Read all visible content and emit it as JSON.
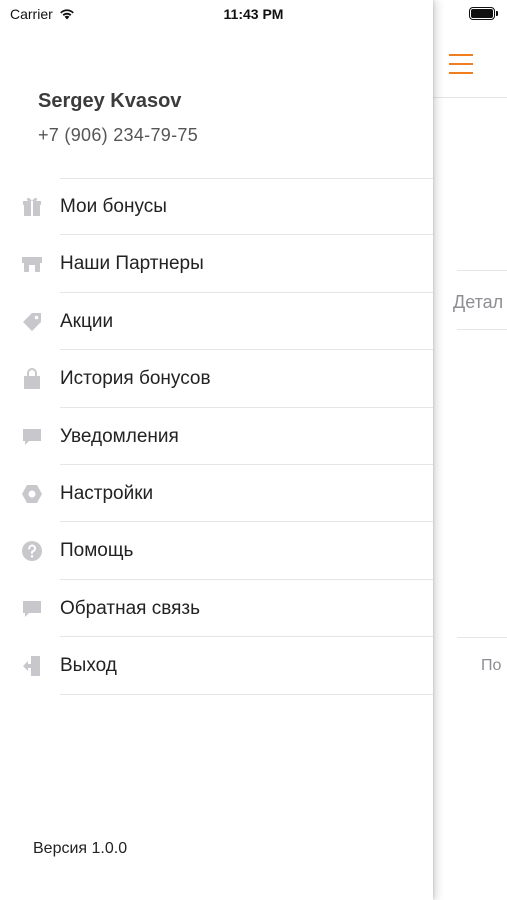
{
  "status_bar": {
    "carrier": "Carrier",
    "time": "11:43 PM"
  },
  "drawer": {
    "user_name": "Sergey Kvasov",
    "user_phone": "+7 (906) 234-79-75",
    "menu": [
      {
        "label": "Мои бонусы",
        "icon": "gift-icon"
      },
      {
        "label": "Наши Партнеры",
        "icon": "store-icon"
      },
      {
        "label": "Акции",
        "icon": "tag-icon"
      },
      {
        "label": "История бонусов",
        "icon": "shopping-bag-icon"
      },
      {
        "label": "Уведомления",
        "icon": "message-icon"
      },
      {
        "label": "Настройки",
        "icon": "settings-icon"
      },
      {
        "label": "Помощь",
        "icon": "help-icon"
      },
      {
        "label": "Обратная связь",
        "icon": "feedback-icon"
      },
      {
        "label": "Выход",
        "icon": "logout-icon"
      }
    ],
    "version": "Версия 1.0.0"
  },
  "main_screen": {
    "details_text": "Детал",
    "bottom_text": "По"
  },
  "colors": {
    "accent": "#f07d1e",
    "icon_gray": "#c8c8cc",
    "divider": "#e6e6e6",
    "secondary_text": "#8e8e93"
  }
}
